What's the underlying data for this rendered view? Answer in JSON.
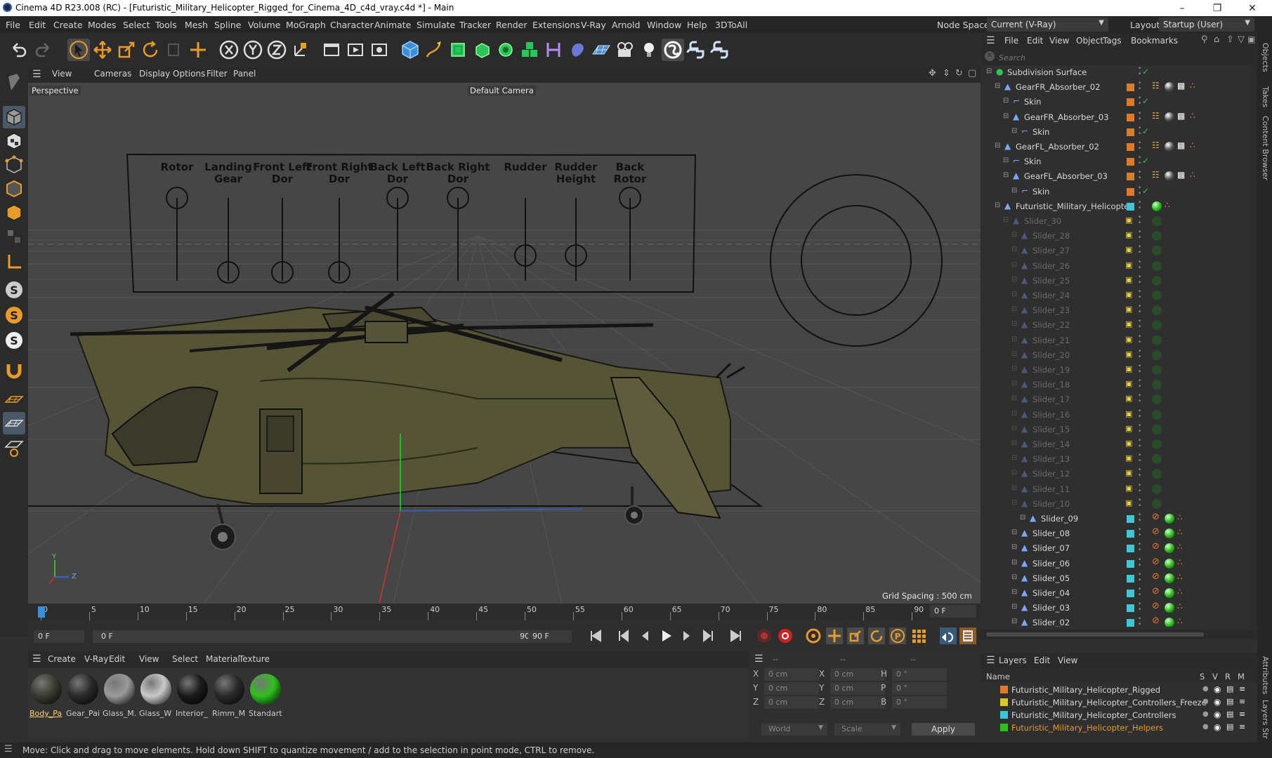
{
  "window": {
    "title": "Cinema 4D R23.008 (RC) - [Futuristic_Military_Helicopter_Rigged_for_Cinema_4D_c4d_vray.c4d *] - Main"
  },
  "menu": [
    "File",
    "Edit",
    "Create",
    "Modes",
    "Select",
    "Tools",
    "Mesh",
    "Spline",
    "Volume",
    "MoGraph",
    "Character",
    "Animate",
    "Simulate",
    "Tracker",
    "Render",
    "Extensions",
    "V-Ray",
    "Arnold",
    "Window",
    "Help",
    "3DToAll"
  ],
  "node_space": {
    "label": "Node Space:",
    "value": "Current (V-Ray)"
  },
  "layout": {
    "label": "Layout:",
    "value": "Startup (User)"
  },
  "viewport": {
    "menu": [
      "View",
      "Cameras",
      "Display",
      "Options",
      "Filter",
      "Panel"
    ],
    "projection": "Perspective",
    "camera": "Default Camera",
    "grid_spacing": "Grid Spacing : 500 cm",
    "slider_labels": [
      [
        "Rotor"
      ],
      [
        "Landing",
        "Gear"
      ],
      [
        "Front Left",
        "Dor"
      ],
      [
        "Front Right",
        "Dor"
      ],
      [
        "Back Left",
        "Dor"
      ],
      [
        "Back Right",
        "Dor"
      ],
      [
        "Rudder"
      ],
      [
        "Rudder",
        "Height"
      ],
      [
        "Back",
        "Rotor"
      ]
    ],
    "axis_labels": {
      "y": "Y",
      "z": "Z"
    }
  },
  "timeline": {
    "ticks": [
      "0",
      "5",
      "10",
      "15",
      "20",
      "25",
      "30",
      "35",
      "40",
      "45",
      "50",
      "55",
      "60",
      "65",
      "70",
      "75",
      "80",
      "85",
      "90"
    ],
    "current_frame": "0 F",
    "start": "0 F",
    "range_start": "0 F",
    "range_end": "90 F",
    "end": "90 F"
  },
  "materials": {
    "menu": [
      "Create",
      "V-Ray",
      "Edit",
      "View",
      "Select",
      "Material",
      "Texture"
    ],
    "items": [
      {
        "label": "Body_Pa",
        "color": "#3a3b30"
      },
      {
        "label": "Gear_Pai",
        "color": "#2a2a2a"
      },
      {
        "label": "Glass_M.",
        "color": "#9a9a9a"
      },
      {
        "label": "Glass_W",
        "color": "#c9c9c9"
      },
      {
        "label": "Interior_",
        "color": "#1a1a1a"
      },
      {
        "label": "Rimm_M",
        "color": "#2a2a2a"
      },
      {
        "label": "Standart",
        "color": "#2fbf1f"
      }
    ]
  },
  "coordinates": {
    "dashes": "--",
    "rows": [
      {
        "a": "X",
        "av": "0 cm",
        "b": "X",
        "bv": "0 cm",
        "c": "H",
        "cv": "0 °"
      },
      {
        "a": "Y",
        "av": "0 cm",
        "b": "Y",
        "bv": "0 cm",
        "c": "P",
        "cv": "0 °"
      },
      {
        "a": "Z",
        "av": "0 cm",
        "b": "Z",
        "bv": "0 cm",
        "c": "B",
        "cv": "0 °"
      }
    ],
    "mode": "World",
    "scale": "Scale",
    "apply": "Apply"
  },
  "objects": {
    "menu": [
      "File",
      "Edit",
      "View",
      "Object",
      "Tags",
      "Bookmarks"
    ],
    "search_placeholder": "Search",
    "items": [
      {
        "name": "Subdivision Surface",
        "indent": 0,
        "tag": "check"
      },
      {
        "name": "GearFR_Absorber_02",
        "indent": 1,
        "tag": "joint",
        "layer": "#e07a2a"
      },
      {
        "name": "Skin",
        "indent": 2,
        "tag": "check",
        "layer": "#e07a2a"
      },
      {
        "name": "GearFR_Absorber_03",
        "indent": 2,
        "tag": "joint",
        "layer": "#e07a2a"
      },
      {
        "name": "Skin",
        "indent": 3,
        "tag": "check",
        "layer": "#e07a2a"
      },
      {
        "name": "GearFL_Absorber_02",
        "indent": 1,
        "tag": "joint",
        "layer": "#e07a2a"
      },
      {
        "name": "Skin",
        "indent": 2,
        "tag": "check",
        "layer": "#e07a2a"
      },
      {
        "name": "GearFL_Absorber_03",
        "indent": 2,
        "tag": "joint",
        "layer": "#e07a2a"
      },
      {
        "name": "Skin",
        "indent": 3,
        "tag": "check",
        "layer": "#e07a2a"
      },
      {
        "name": "Futuristic_Military_Helicopter",
        "indent": 1,
        "tag": "green",
        "layer": "#37c9d6"
      },
      {
        "name": "Slider_30",
        "indent": 2,
        "tag": "lock",
        "dim": true
      },
      {
        "name": "Slider_28",
        "indent": 3,
        "tag": "lock",
        "dim": true
      },
      {
        "name": "Slider_27",
        "indent": 3,
        "tag": "lock",
        "dim": true
      },
      {
        "name": "Slider_26",
        "indent": 3,
        "tag": "lock",
        "dim": true
      },
      {
        "name": "Slider_25",
        "indent": 3,
        "tag": "lock",
        "dim": true
      },
      {
        "name": "Slider_24",
        "indent": 3,
        "tag": "lock",
        "dim": true
      },
      {
        "name": "Slider_23",
        "indent": 3,
        "tag": "lock",
        "dim": true
      },
      {
        "name": "Slider_22",
        "indent": 3,
        "tag": "lock",
        "dim": true
      },
      {
        "name": "Slider_21",
        "indent": 3,
        "tag": "lock",
        "dim": true
      },
      {
        "name": "Slider_20",
        "indent": 3,
        "tag": "lock",
        "dim": true
      },
      {
        "name": "Slider_19",
        "indent": 3,
        "tag": "lock",
        "dim": true
      },
      {
        "name": "Slider_18",
        "indent": 3,
        "tag": "lock",
        "dim": true
      },
      {
        "name": "Slider_17",
        "indent": 3,
        "tag": "lock",
        "dim": true
      },
      {
        "name": "Slider_16",
        "indent": 3,
        "tag": "lock",
        "dim": true
      },
      {
        "name": "Slider_15",
        "indent": 3,
        "tag": "lock",
        "dim": true
      },
      {
        "name": "Slider_14",
        "indent": 3,
        "tag": "lock",
        "dim": true
      },
      {
        "name": "Slider_13",
        "indent": 3,
        "tag": "lock",
        "dim": true
      },
      {
        "name": "Slider_12",
        "indent": 3,
        "tag": "lock",
        "dim": true
      },
      {
        "name": "Slider_11",
        "indent": 3,
        "tag": "lock",
        "dim": true
      },
      {
        "name": "Slider_10",
        "indent": 3,
        "tag": "lock",
        "dim": true
      },
      {
        "name": "Slider_09",
        "indent": 4,
        "tag": "ctrl",
        "layer": "#37c9d6"
      },
      {
        "name": "Slider_08",
        "indent": 3,
        "tag": "ctrl",
        "layer": "#37c9d6"
      },
      {
        "name": "Slider_07",
        "indent": 3,
        "tag": "ctrl",
        "layer": "#37c9d6"
      },
      {
        "name": "Slider_06",
        "indent": 3,
        "tag": "ctrl",
        "layer": "#37c9d6"
      },
      {
        "name": "Slider_05",
        "indent": 3,
        "tag": "ctrl",
        "layer": "#37c9d6"
      },
      {
        "name": "Slider_04",
        "indent": 3,
        "tag": "ctrl",
        "layer": "#37c9d6"
      },
      {
        "name": "Slider_03",
        "indent": 3,
        "tag": "ctrl",
        "layer": "#37c9d6"
      },
      {
        "name": "Slider_02",
        "indent": 3,
        "tag": "ctrl",
        "layer": "#37c9d6"
      }
    ]
  },
  "layers": {
    "menu": [
      "Layers",
      "Edit",
      "View"
    ],
    "headers": {
      "name": "Name",
      "s": "S",
      "v": "V",
      "r": "R",
      "m": "M"
    },
    "items": [
      {
        "name": "Futuristic_Military_Helicopter_Rigged",
        "color": "#e07a2a"
      },
      {
        "name": "Futuristic_Military_Helicopter_Controllers_Freeze",
        "color": "#d8c82a"
      },
      {
        "name": "Futuristic_Military_Helicopter_Controllers",
        "color": "#37c9d6"
      },
      {
        "name": "Futuristic_Military_Helicopter_Helpers",
        "color": "#2fbf1f",
        "highlight": true
      }
    ]
  },
  "right_tabs": [
    "Objects",
    "Takes",
    "Content Browser",
    "Attributes",
    "Layers",
    "Str"
  ],
  "status": "Move: Click and drag to move elements. Hold down SHIFT to quantize movement / add to the selection in point mode, CTRL to remove."
}
